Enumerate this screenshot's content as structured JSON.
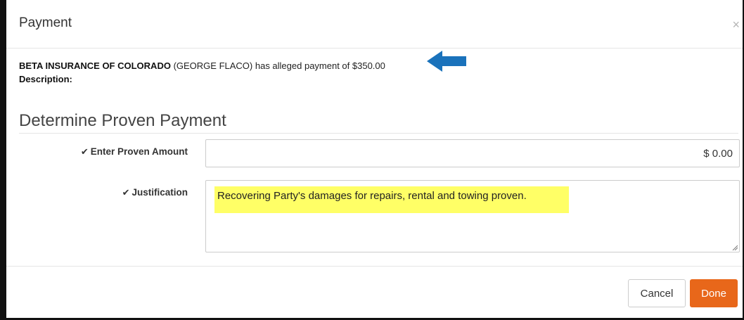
{
  "modal": {
    "title": "Payment",
    "close_glyph": "×"
  },
  "summary": {
    "insurer": "BETA INSURANCE OF COLORADO",
    "rest": " (GEORGE FLACO) has alleged payment of $350.00",
    "description_label": "Description:"
  },
  "annotation": {
    "arrow_icon": "blue-left-arrow",
    "arrow_color": "#1a72bb"
  },
  "section": {
    "title": "Determine Proven Payment"
  },
  "form": {
    "amount_label": "Enter Proven Amount",
    "amount_value": "$ 0.00",
    "justification_label": "Justification",
    "justification_text": "Recovering Party's damages for repairs, rental and towing proven.",
    "check_icon": "check-icon",
    "highlight_color": "#ffff66"
  },
  "footer": {
    "cancel_label": "Cancel",
    "done_label": "Done",
    "done_color": "#e8671a"
  }
}
